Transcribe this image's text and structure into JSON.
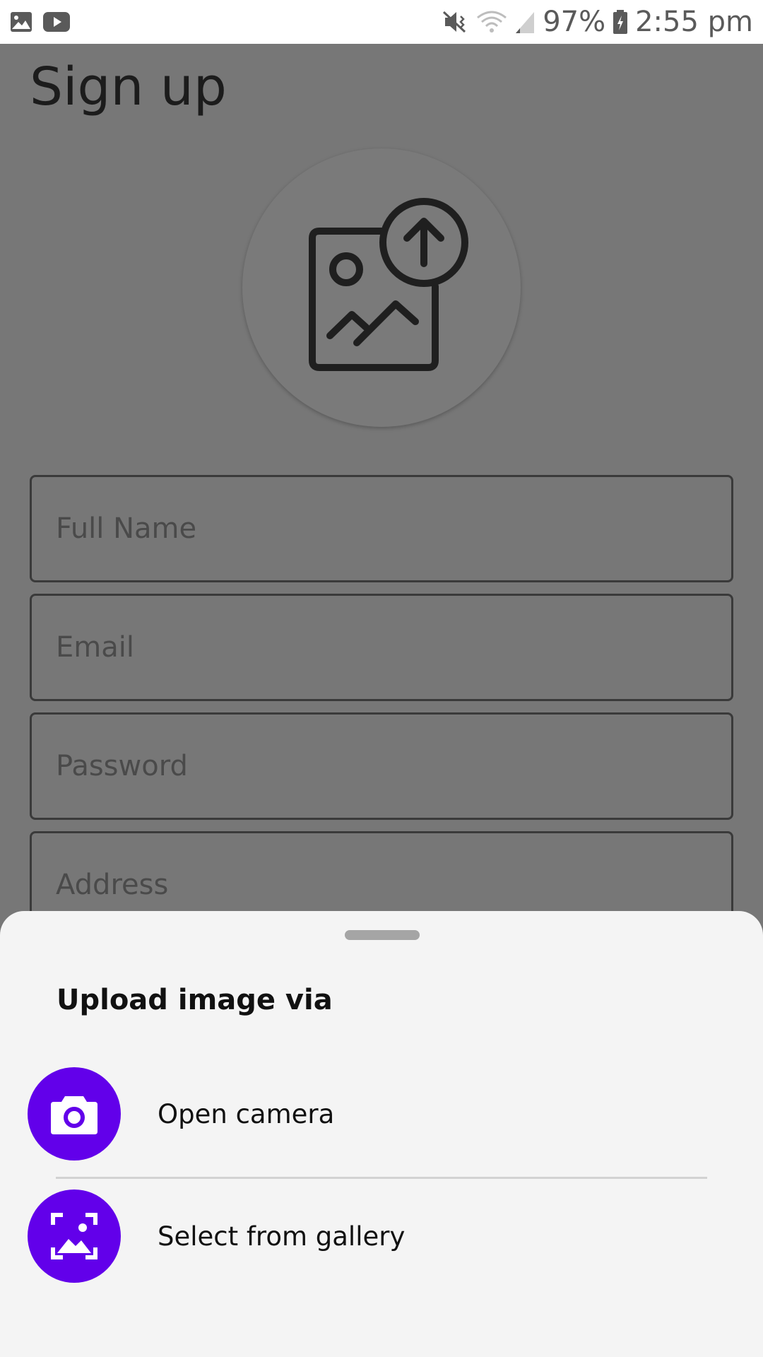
{
  "status_bar": {
    "battery_percent": "97%",
    "time": "2:55 pm",
    "icons": [
      "image-icon",
      "youtube-icon",
      "mute-vibrate-icon",
      "wifi-icon",
      "signal-icon",
      "battery-charging-icon"
    ]
  },
  "page": {
    "title": "Sign up",
    "avatar_icon": "image-upload-icon",
    "fields": [
      {
        "placeholder": "Full Name"
      },
      {
        "placeholder": "Email"
      },
      {
        "placeholder": "Password"
      },
      {
        "placeholder": "Address"
      }
    ]
  },
  "sheet": {
    "title": "Upload image via",
    "options": [
      {
        "label": "Open camera",
        "icon": "camera-icon"
      },
      {
        "label": "Select from gallery",
        "icon": "gallery-icon"
      }
    ],
    "accent_color": "#6200ea"
  }
}
